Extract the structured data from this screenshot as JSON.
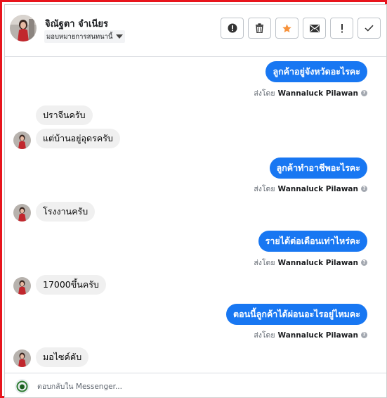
{
  "header": {
    "contact_name": "จิณัฐตา จำเนียร",
    "assign_label": "มอบหมายการสนทนานี้"
  },
  "actions": [
    "info-circle-icon",
    "trash-icon",
    "star-icon",
    "envelope-icon",
    "exclamation-icon",
    "check-icon"
  ],
  "colors": {
    "accent": "#1877f2",
    "star": "#f7923b",
    "border": "#e8141c"
  },
  "messages": [
    {
      "dir": "out",
      "text": "ลูกค้าอยู่จังหวัดอะไรคะ",
      "sent_prefix": "ส่งโดย",
      "sender": "Wannaluck Pilawan"
    },
    {
      "dir": "in",
      "text": "ปราจีนครับ"
    },
    {
      "dir": "in",
      "text": "แต่บ้านอยู่อุดรครับ"
    },
    {
      "dir": "out",
      "text": "ลูกค้าทำอาชีพอะไรคะ",
      "sent_prefix": "ส่งโดย",
      "sender": "Wannaluck Pilawan"
    },
    {
      "dir": "in",
      "text": "โรงงานครับ"
    },
    {
      "dir": "out",
      "text": "รายได้ต่อเดือนเท่าไหร่คะ",
      "sent_prefix": "ส่งโดย",
      "sender": "Wannaluck Pilawan"
    },
    {
      "dir": "in",
      "text": "17000ขึ้นครับ"
    },
    {
      "dir": "out",
      "text": "ตอนนี้ลูกค้าได้ผ่อนอะไรอยู่ไหมคะ",
      "sent_prefix": "ส่งโดย",
      "sender": "Wannaluck Pilawan"
    },
    {
      "dir": "in",
      "text": "มอไซค์คับ"
    }
  ],
  "footer": {
    "reply_placeholder": "ตอบกลับใน Messenger..."
  }
}
